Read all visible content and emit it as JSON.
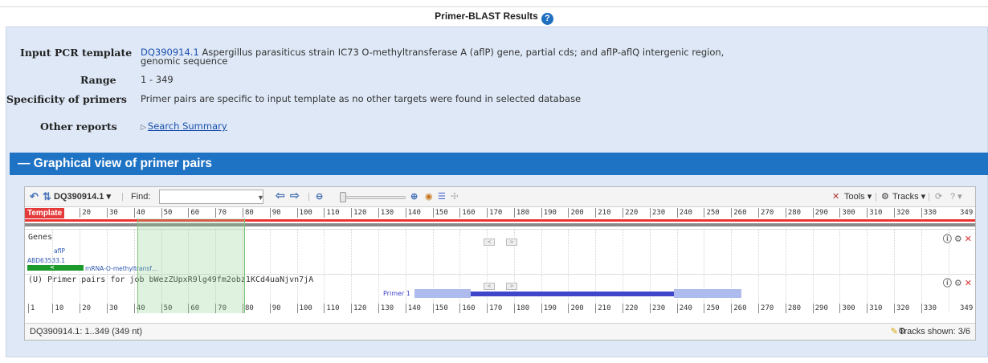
{
  "page_title": "Primer-BLAST Results",
  "summary": {
    "input_label": "Input PCR template",
    "accession": "DQ390914.1",
    "description_line1": "Aspergillus parasiticus strain IC73 O-methyltransferase A (aflP) gene, partial cds; and aflP-aflQ intergenic region,",
    "description_line2": "genomic sequence",
    "range_label": "Range",
    "range_value": "1 - 349",
    "specificity_label": "Specificity of primers",
    "specificity_value": "Primer pairs are specific to input template as no other targets were found in selected database",
    "other_reports_label": "Other reports",
    "other_reports_link": "Search Summary"
  },
  "section_header": "— Graphical view of primer pairs",
  "viewer": {
    "sequence_menu": "DQ390914.1",
    "find_label": "Find:",
    "find_value": "",
    "tools_label": "Tools",
    "tracks_label": "Tracks",
    "template_label": "Template",
    "top_ruler": [
      "20",
      "30",
      "40",
      "50",
      "60",
      "70",
      "80",
      "90",
      "100",
      "110",
      "120",
      "130",
      "140",
      "150",
      "160",
      "170",
      "180",
      "190",
      "200",
      "210",
      "220",
      "230",
      "240",
      "250",
      "260",
      "270",
      "280",
      "290",
      "300",
      "310",
      "320",
      "330",
      "349"
    ],
    "bottom_ruler": [
      "1",
      "10",
      "20",
      "30",
      "40",
      "50",
      "60",
      "70",
      "80",
      "90",
      "100",
      "110",
      "120",
      "130",
      "140",
      "150",
      "160",
      "170",
      "180",
      "190",
      "200",
      "210",
      "220",
      "230",
      "240",
      "250",
      "260",
      "270",
      "280",
      "290",
      "300",
      "310",
      "320",
      "330",
      "349"
    ],
    "genes_track": {
      "title": "Genes",
      "gene_name": "aflP",
      "protein_id": "ABD63533.1",
      "mrna_label": "mRNA-O-methyltransf…"
    },
    "primer_track": {
      "title": "(U) Primer pairs for job bWezZUpxR9lg49fm2obz1KCd4uaNjvn7jA",
      "primer_label": "Primer 1"
    },
    "status_left": "DQ390914.1: 1..349 (349 nt)",
    "status_right": "Tracks shown: 3/6"
  },
  "colors": {
    "header_blue": "#1f73c4",
    "panel_bg": "#dee8f6",
    "template_red": "#e53a3a",
    "gene_green": "#1c9a2c",
    "primer_blue": "#3f46c9",
    "primer_light": "#aebbee"
  },
  "icons": [
    "help-icon",
    "undo-icon",
    "refresh-icon",
    "back-arrow-icon",
    "forward-arrow-icon",
    "zoom-out-icon",
    "zoom-in-icon",
    "wrench-icon",
    "gear-icon",
    "pencil-icon"
  ]
}
